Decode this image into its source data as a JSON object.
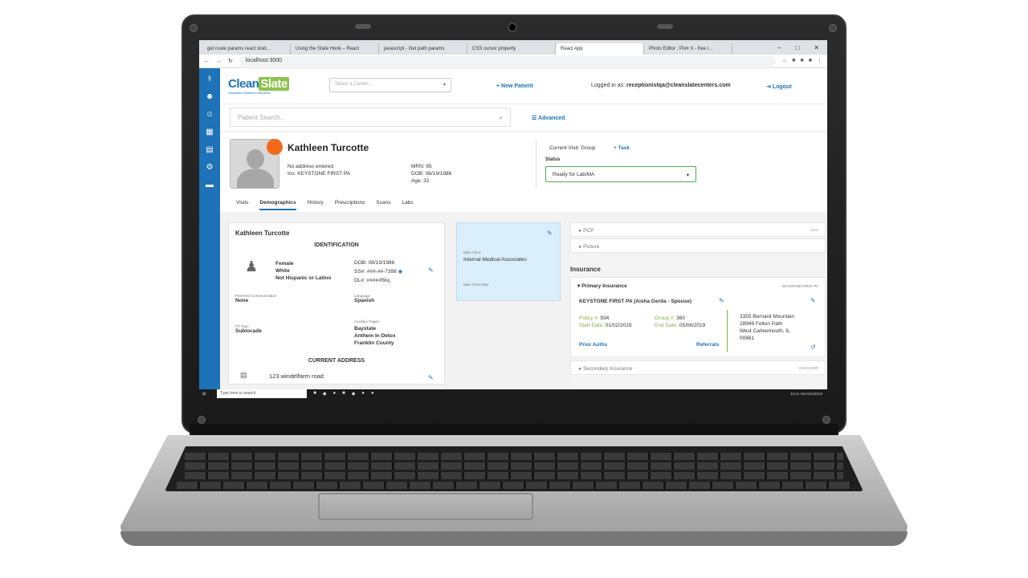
{
  "browser": {
    "tabs": [
      {
        "label": "get route params react stud..."
      },
      {
        "label": "Using the State Hook – React"
      },
      {
        "label": "javascript - Get path params"
      },
      {
        "label": "CSS cursor property"
      },
      {
        "label": "React App"
      },
      {
        "label": "Photo Editor : Pixlr X - free i..."
      }
    ],
    "url": "localhost:3000"
  },
  "header": {
    "logo": "Clean",
    "logo_highlight": "Slate",
    "logo_sub": "Outpatient Addiction Medicine",
    "center_placeholder": "Select a Center...",
    "new_patient": "New Patient",
    "logged_in_label": "Logged in as:",
    "logged_in_user": "receptionistqa@cleanslatecenters.com",
    "logout": "Logout"
  },
  "search": {
    "placeholder": "Patient Search...",
    "advanced": "Advanced"
  },
  "patient": {
    "name": "Kathleen Turcotte",
    "address": "No address entered",
    "ins": "Ins: KEYSTONE FIRST PA",
    "mrn": "MRN: 95",
    "dob": "DOB: 08/19/1986",
    "age": "Age: 32",
    "current_visit_label": "Current Visit:",
    "current_visit": "Group",
    "task": "Task",
    "status_label": "Status",
    "status": "Ready for Lab/MA"
  },
  "patient_tabs": [
    "Visits",
    "Demographics",
    "History",
    "Prescriptions",
    "Scans",
    "Labs"
  ],
  "demographics": {
    "name": "Kathleen Turcotte",
    "identification": "IDENTIFICATION",
    "sex": "Female",
    "race": "White",
    "ethnicity": "Not Hispanic or Latino",
    "dob": "DOB: 08/19/1986",
    "ssn": "SS#: ###-##-7398",
    "dl": "DL#: #####f9oj",
    "pref_comm_label": "Preferred Communication",
    "pref_comm": "None",
    "language_label": "Language",
    "language": "Spanish",
    "pt_type_label": "PT Type",
    "pt_type": "Sublocade",
    "aux_label": "Auxiliary Pages",
    "aux_1": "Baystate",
    "aux_2": "Anthem In Detox",
    "aux_3": "Franklin County",
    "current_address": "CURRENT ADDRESS",
    "address_line": "123 windelfarm road"
  },
  "clinic": {
    "main_clinic_label": "Main Clinic",
    "main_clinic": "Internal Medical Associates",
    "main_prescriber_label": "Main Prescriber"
  },
  "insurance_panel": {
    "pcp": "PCP",
    "pcp_value": "none",
    "picture": "Picture",
    "insurance_title": "Insurance",
    "primary": "Primary Insurance",
    "primary_value": "KEYSTONE FIRST PA",
    "plan": "KEYSTONE FIRST PA (Aisha Gerda - Spouse)",
    "policy_label": "Policy #:",
    "policy": "934",
    "group_label": "Group #:",
    "group": "360",
    "start_label": "Start Date:",
    "start": "01/02/2019",
    "end_label": "End Date:",
    "end": "05/08/2019",
    "addr1": "3355 Bernard Mountain",
    "addr2": "28949 Felton Path",
    "addr3": "West Carleemouth, IL",
    "addr4": "00861",
    "prior_auths": "Prior Auths",
    "referrals": "Referrals",
    "secondary": "Secondary Insurance",
    "secondary_value": "DES/CMDP"
  },
  "taskbar": {
    "search": "Type here to search",
    "time": "10:11 AM",
    "date": "6/11/2019"
  }
}
